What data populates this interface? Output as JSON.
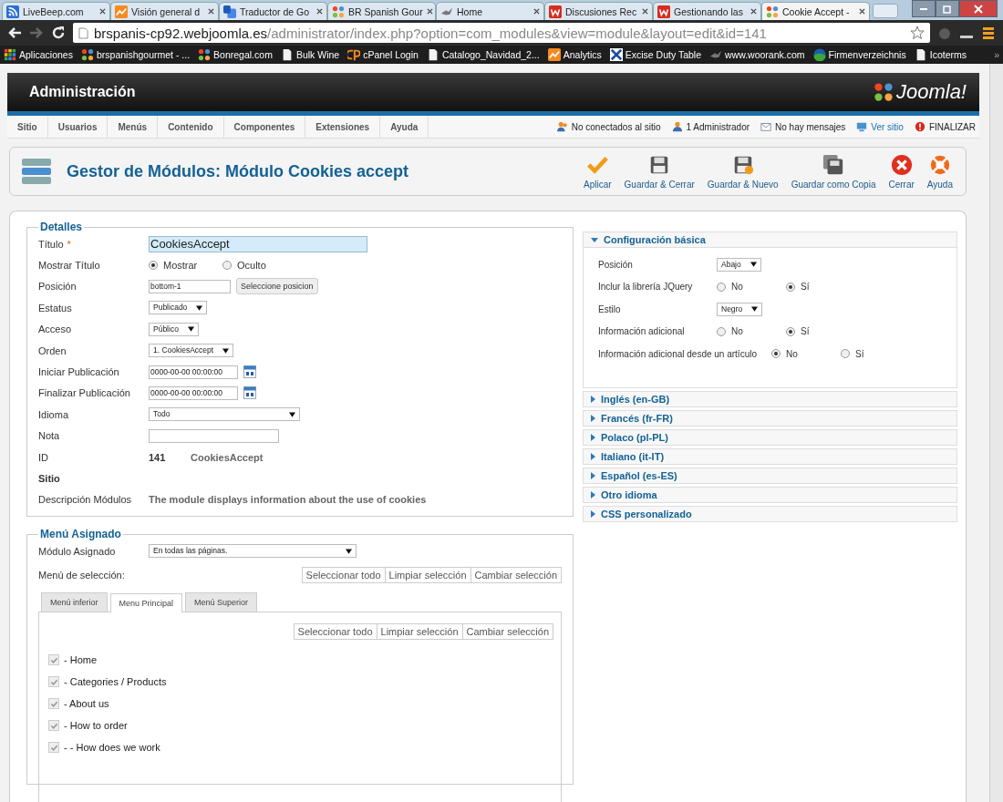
{
  "browser": {
    "tabs": [
      {
        "label": "LiveBeep.com",
        "kind": "rss",
        "selected": false
      },
      {
        "label": "Visión general d",
        "kind": "chart",
        "selected": false
      },
      {
        "label": "Traductor de Go",
        "kind": "translate",
        "selected": false
      },
      {
        "label": "BR Spanish Gour",
        "kind": "joomla",
        "selected": false
      },
      {
        "label": "Home",
        "kind": "bird",
        "selected": false
      },
      {
        "label": "Discusiones Rec",
        "kind": "w",
        "selected": false
      },
      {
        "label": "Gestionando las",
        "kind": "w",
        "selected": false
      },
      {
        "label": "Cookie Accept -",
        "kind": "joomla",
        "selected": true
      }
    ],
    "url_host": "brspanis-cp92.webjoomla.es",
    "url_path": "/administrator/index.php?option=com_modules&view=module&layout=edit&id=141",
    "bookmarks": [
      {
        "label": "Aplicaciones",
        "kind": "apps"
      },
      {
        "label": "brspanishgourmet - ...",
        "kind": "joomla"
      },
      {
        "label": "Bonregal.com",
        "kind": "joomla"
      },
      {
        "label": "Bulk Wine",
        "kind": "page"
      },
      {
        "label": "cPanel Login",
        "kind": "cpanel"
      },
      {
        "label": "Catalogo_Navidad_2...",
        "kind": "page"
      },
      {
        "label": "Analytics",
        "kind": "chart"
      },
      {
        "label": "Excise Duty Table",
        "kind": "excise"
      },
      {
        "label": "www.woorank.com",
        "kind": "bird"
      },
      {
        "label": "Firmenverzeichnis",
        "kind": "globe"
      },
      {
        "label": "Icoterms",
        "kind": "page"
      }
    ],
    "more": "»"
  },
  "header": {
    "title": "Administración",
    "logo": "Joomla!"
  },
  "menu": {
    "items": [
      "Sitio",
      "Usuarios",
      "Menús",
      "Contenido",
      "Componentes",
      "Extensiones",
      "Ayuda"
    ],
    "status": [
      {
        "label": "No conectados al sitio",
        "kind": "users"
      },
      {
        "label": "1 Administrador",
        "kind": "user"
      },
      {
        "label": "No hay mensajes",
        "kind": "mail"
      },
      {
        "label": "Ver sitio",
        "kind": "link"
      },
      {
        "label": "FINALIZAR",
        "kind": "logout"
      }
    ]
  },
  "toolbar": {
    "title": "Gestor de Módulos: Módulo Cookies accept",
    "buttons": [
      {
        "label": "Aplicar",
        "kind": "apply"
      },
      {
        "label": "Guardar & Cerrar",
        "kind": "save"
      },
      {
        "label": "Guardar & Nuevo",
        "kind": "save-new"
      },
      {
        "label": "Guardar como Copia",
        "kind": "save-copy"
      },
      {
        "label": "Cerrar",
        "kind": "close"
      },
      {
        "label": "Ayuda",
        "kind": "help"
      }
    ]
  },
  "details": {
    "legend": "Detalles",
    "fields": [
      {
        "kind": "text",
        "label": "Título",
        "required": "*",
        "value": "CookiesAccept"
      },
      {
        "kind": "radio",
        "label": "Mostrar Título",
        "options": [
          {
            "label": "Mostrar",
            "selected": true
          },
          {
            "label": "Oculto",
            "selected": false
          }
        ]
      },
      {
        "kind": "position",
        "label": "Posición",
        "value": "bottom-1",
        "button": "Seleccione posicion"
      },
      {
        "kind": "select",
        "label": "Estatus",
        "value": "Publicado"
      },
      {
        "kind": "select",
        "label": "Acceso",
        "value": "Público"
      },
      {
        "kind": "select",
        "label": "Orden",
        "value": "1. CookiesAccept"
      },
      {
        "kind": "date",
        "label": "Iniciar Publicación",
        "value": "0000-00-00 00:00:00"
      },
      {
        "kind": "date",
        "label": "Finalizar Publicación",
        "value": "0000-00-00 00:00:00"
      },
      {
        "kind": "wide-select",
        "label": "Idioma",
        "value": "Todo"
      },
      {
        "kind": "empty",
        "label": "Nota"
      },
      {
        "kind": "id",
        "label": "ID",
        "value": "141",
        "name": "CookiesAccept"
      },
      {
        "kind": "heading",
        "label": "Sitio"
      },
      {
        "kind": "info",
        "label": "Descripción Módulos",
        "value": "The module displays information about the use of cookies"
      }
    ]
  },
  "config": {
    "title": "Configuración básica",
    "expanded": true,
    "rows": [
      {
        "kind": "select",
        "label": "Posición",
        "value": "Abajo"
      },
      {
        "kind": "radio",
        "label": "Inclur la librería JQuery",
        "options": [
          {
            "label": "No",
            "selected": false
          },
          {
            "label": "Sí",
            "selected": true
          }
        ]
      },
      {
        "kind": "select",
        "label": "Estilo",
        "value": "Negro"
      },
      {
        "kind": "radio",
        "label": "Información adicional",
        "options": [
          {
            "label": "No",
            "selected": false
          },
          {
            "label": "Sí",
            "selected": true
          }
        ]
      },
      {
        "kind": "radio",
        "label": "Información adicional desde un artículo",
        "options": [
          {
            "label": "No",
            "selected": true
          },
          {
            "label": "Sí",
            "selected": false
          }
        ]
      }
    ],
    "sections": [
      {
        "title": "Inglés (en-GB)",
        "expanded": false
      },
      {
        "title": "Francés (fr-FR)",
        "expanded": false
      },
      {
        "title": "Polaco (pl-PL)",
        "expanded": false
      },
      {
        "title": "Italiano (it-IT)",
        "expanded": false
      },
      {
        "title": "Español (es-ES)",
        "expanded": false
      },
      {
        "title": "Otro idioma",
        "expanded": false
      },
      {
        "title": "CSS personalizado",
        "expanded": false
      }
    ]
  },
  "assignment": {
    "legend": "Menú Asignado",
    "label": "Módulo Asignado",
    "value": "En todas las páginas.",
    "selection_label": "Menú de selección:",
    "actions": [
      "Seleccionar todo",
      "Limpiar selección",
      "Cambiar selección"
    ],
    "tabs": [
      {
        "label": "Menú inferior",
        "selected": false
      },
      {
        "label": "Menu Principal",
        "selected": true
      },
      {
        "label": "Menú Superior",
        "selected": false
      }
    ],
    "tab_actions": [
      "Seleccionar todo",
      "Limpiar selección",
      "Cambiar selección"
    ],
    "items": [
      {
        "label": "- Home",
        "checked": true,
        "disabled": true
      },
      {
        "label": "- Categories / Products",
        "checked": true,
        "disabled": true
      },
      {
        "label": "- About us",
        "checked": true,
        "disabled": true
      },
      {
        "label": "- How to order",
        "checked": true,
        "disabled": true
      },
      {
        "label": "- - How does we work",
        "checked": true,
        "disabled": true
      }
    ]
  }
}
